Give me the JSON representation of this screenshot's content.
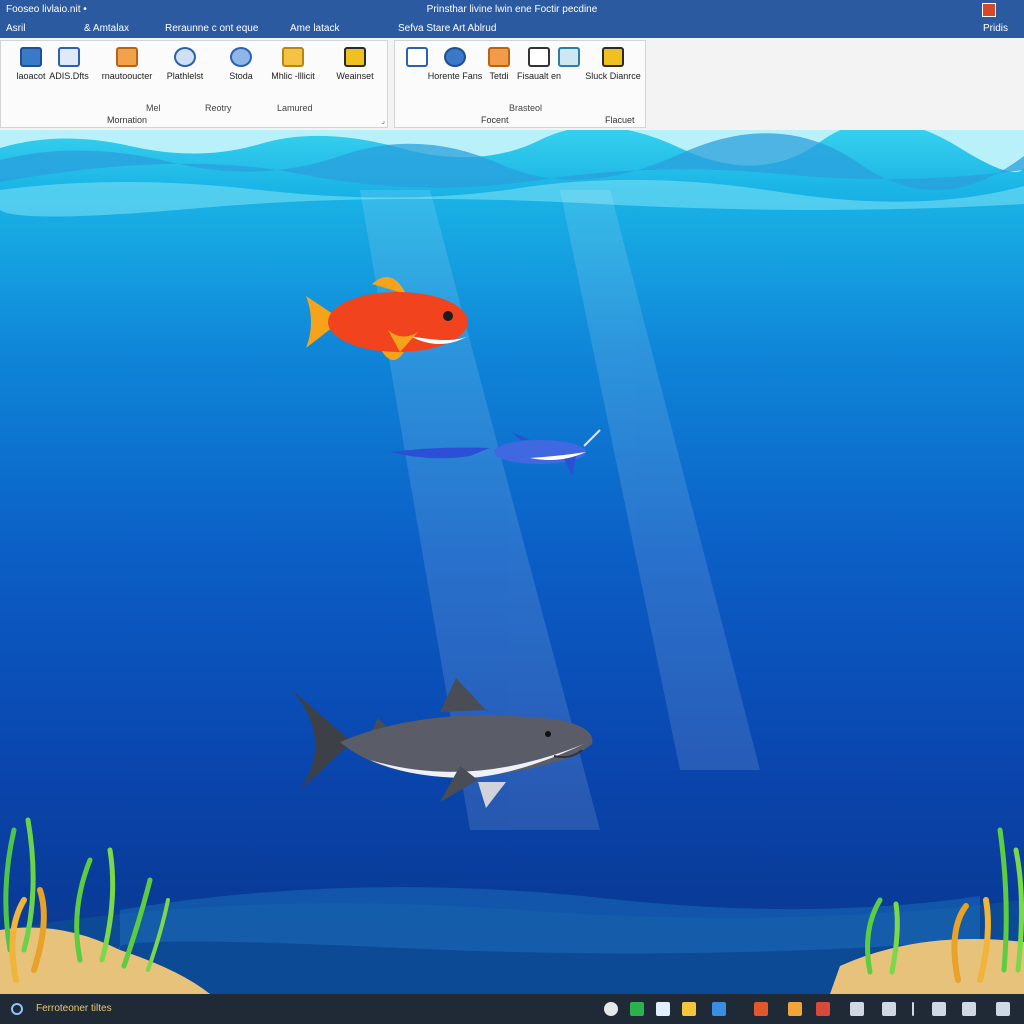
{
  "titlebar": {
    "left_text": "Fooseo livlaio.nit  •",
    "title": "Prinsthar livine lwin ene Foctir pecdine",
    "right_label": "Pridis"
  },
  "menu": {
    "items": [
      "Asril",
      "& Amtalax",
      "Reraunne c ont eque",
      "Ame latack",
      "Sefva Stare Art Ablrud"
    ]
  },
  "ribbon": {
    "group1": {
      "buttons": [
        "laoacot",
        "ADIS.Dfts",
        "rnautooucter",
        "Plathlelst",
        "Stoda",
        "Mhlic -lllicit",
        "Weainset"
      ],
      "sublabels": [
        "Mel",
        "Reotry",
        "Lamured"
      ],
      "label": "Mornation"
    },
    "group2": {
      "buttons": [
        "Horente Fans",
        "Tetdi",
        "Fisaualt en",
        "Sluck Dianrce"
      ],
      "sublabels": [
        "Brasteol"
      ],
      "label": "Focent",
      "label2": "Flacuet"
    }
  },
  "taskbar": {
    "status": "Ferroteoner tiltes"
  },
  "colors": {
    "titlebar": "#2c5aa0",
    "ribbon": "#f3f3f3",
    "fish": "#f0431e",
    "fin": "#f6a21a",
    "shark": "#5a5d68"
  }
}
